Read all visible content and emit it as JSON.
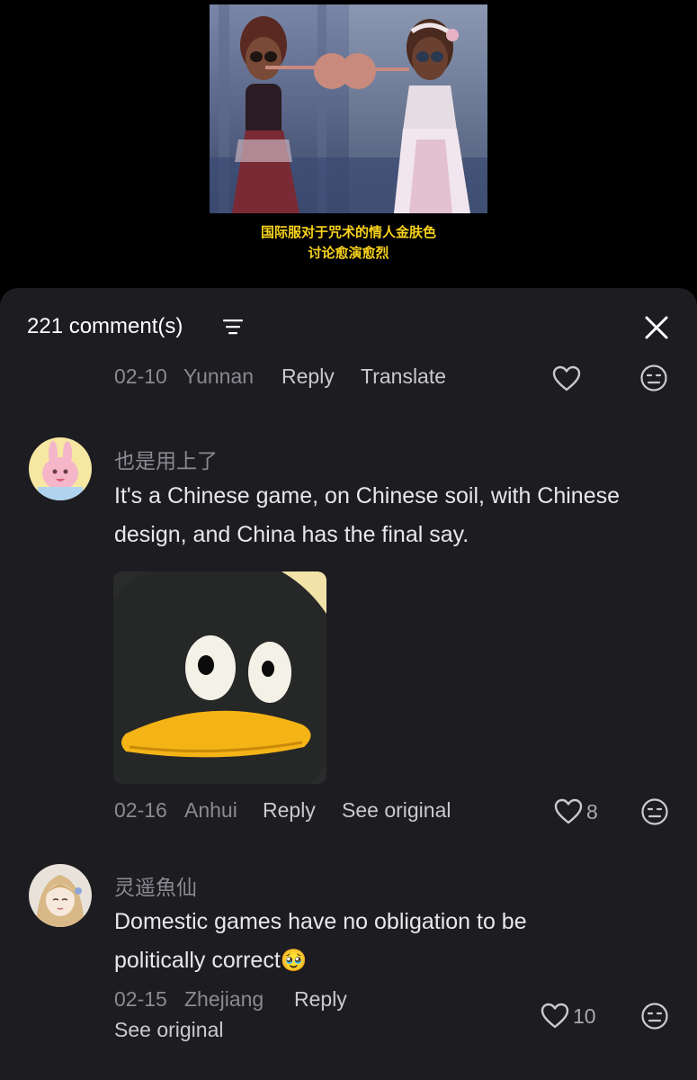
{
  "video": {
    "caption_line1": "国际服对于咒术的情人金肤色",
    "caption_line2": "讨论愈演愈烈"
  },
  "comments_header": {
    "count_label": "221 comment(s)",
    "sort_icon": "sort-icon",
    "close_icon": "close-icon"
  },
  "comments": [
    {
      "date": "02-10",
      "location": "Yunnan",
      "reply_label": "Reply",
      "action_label": "Translate",
      "likes": ""
    },
    {
      "username": "也是用上了",
      "text": "It's a Chinese game, on Chinese soil, with Chinese design, and China has the final say.",
      "has_sticker": true,
      "date": "02-16",
      "location": "Anhui",
      "reply_label": "Reply",
      "action_label": "See original",
      "likes": "8"
    },
    {
      "username": "灵遥魚仙",
      "text": "Domestic games have no obligation to be politically correct",
      "emoji": "🥹",
      "date": "02-15",
      "location": "Zhejiang",
      "reply_label": "Reply",
      "action_label": "See original",
      "likes": "10"
    }
  ],
  "colors": {
    "sheet_bg": "#1c1c21",
    "caption_yellow": "#f7d21c",
    "meta_gray": "#8a8a91"
  }
}
